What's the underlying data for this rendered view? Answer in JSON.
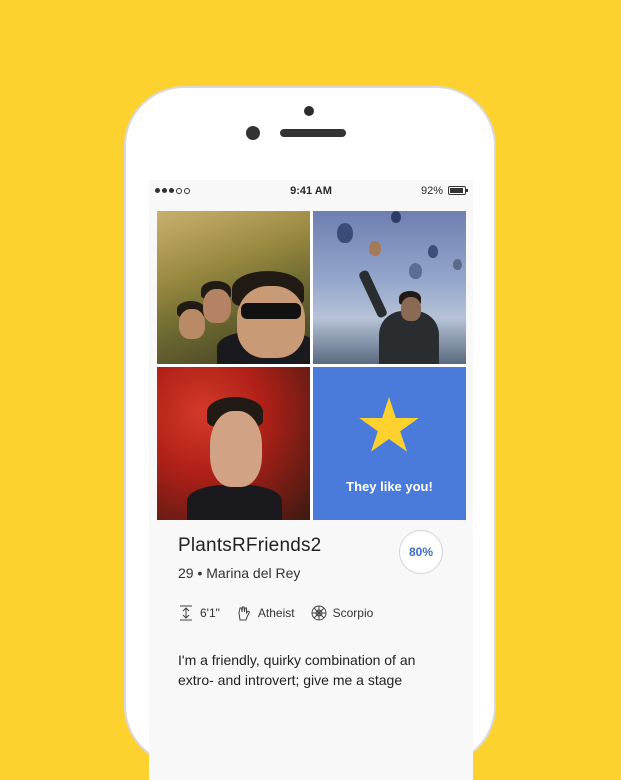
{
  "status_bar": {
    "time": "9:41 AM",
    "battery_percent": "92%",
    "battery_level": 0.92,
    "signal_bars": 3
  },
  "photos": [
    {
      "name": "group-selfie-photo"
    },
    {
      "name": "balloons-photo"
    },
    {
      "name": "poppy-field-portrait-photo"
    }
  ],
  "like_card": {
    "icon": "star-icon",
    "label": "They like you!",
    "color": "#4A7BDB",
    "star_color": "#FDD22F"
  },
  "profile": {
    "username": "PlantsRFriends2",
    "age_location": "29 • Marina del Rey",
    "match_percent": "80%",
    "details": [
      {
        "icon": "height-icon",
        "label": "6'1\""
      },
      {
        "icon": "hand-icon",
        "label": "Atheist"
      },
      {
        "icon": "zodiac-icon",
        "label": "Scorpio"
      }
    ],
    "bio": "I'm a friendly, quirky combination of an extro- and introvert; give me a stage"
  },
  "colors": {
    "background": "#FDD22F",
    "accent": "#3C6EC7"
  }
}
